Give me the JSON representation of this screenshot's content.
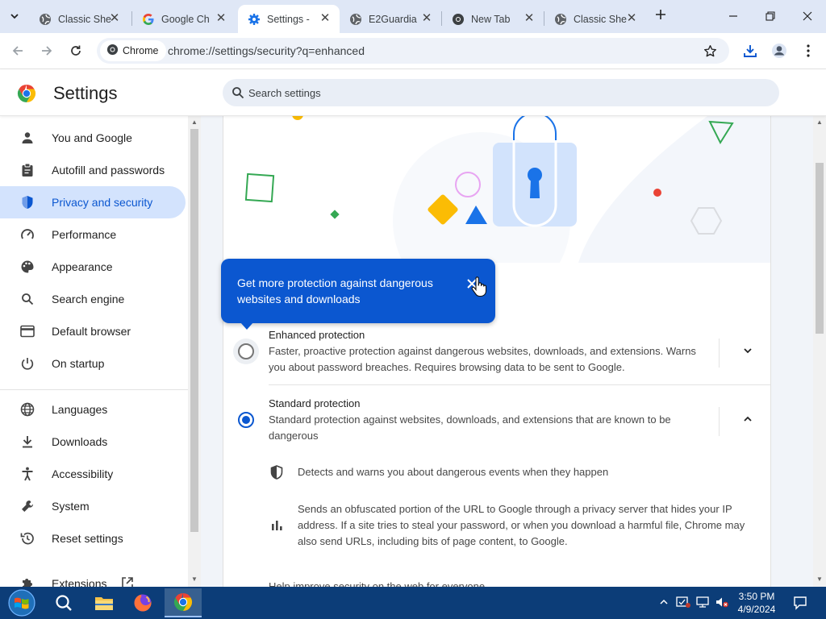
{
  "tabs": [
    {
      "title": "Classic She",
      "favicon": "globe-icon",
      "active": false
    },
    {
      "title": "Google Ch",
      "favicon": "google-icon",
      "active": false
    },
    {
      "title": "Settings -",
      "favicon": "settings-gear-icon",
      "active": true
    },
    {
      "title": "E2Guardia",
      "favicon": "globe-icon",
      "active": false
    },
    {
      "title": "New Tab",
      "favicon": "chrome-icon",
      "active": false
    },
    {
      "title": "Classic She",
      "favicon": "globe-icon",
      "active": false
    }
  ],
  "toolbar": {
    "chip_label": "Chrome",
    "url": "chrome://settings/security?q=enhanced"
  },
  "header": {
    "title": "Settings",
    "search_placeholder": "Search settings"
  },
  "sidebar": {
    "items": [
      {
        "label": "You and Google",
        "icon": "person-icon"
      },
      {
        "label": "Autofill and passwords",
        "icon": "clipboard-icon"
      },
      {
        "label": "Privacy and security",
        "icon": "shield-icon",
        "active": true
      },
      {
        "label": "Performance",
        "icon": "speedometer-icon"
      },
      {
        "label": "Appearance",
        "icon": "palette-icon"
      },
      {
        "label": "Search engine",
        "icon": "search-icon"
      },
      {
        "label": "Default browser",
        "icon": "browser-window-icon"
      },
      {
        "label": "On startup",
        "icon": "power-icon"
      },
      {
        "label": "Languages",
        "icon": "globe-icon"
      },
      {
        "label": "Downloads",
        "icon": "download-icon"
      },
      {
        "label": "Accessibility",
        "icon": "accessibility-icon"
      },
      {
        "label": "System",
        "icon": "wrench-icon"
      },
      {
        "label": "Reset settings",
        "icon": "history-icon"
      },
      {
        "label": "Extensions",
        "icon": "puzzle-icon"
      }
    ]
  },
  "bubble": {
    "text": "Get more protection against dangerous websites and downloads"
  },
  "options": {
    "enhanced": {
      "title": "Enhanced protection",
      "desc": "Faster, proactive protection against dangerous websites, downloads, and extensions. Warns you about password breaches. Requires browsing data to be sent to Google.",
      "selected": false
    },
    "standard": {
      "title": "Standard protection",
      "desc": "Standard protection against websites, downloads, and extensions that are known to be dangerous",
      "selected": true,
      "details": [
        "Detects and warns you about dangerous events when they happen",
        "Sends an obfuscated portion of the URL to Google through a privacy server that hides your IP address. If a site tries to steal your password, or when you download a harmful file, Chrome may also send URLs, including bits of page content, to Google."
      ],
      "cut_off_text": "Help improve security on the web for everyone"
    }
  },
  "taskbar": {
    "time": "3:50 PM",
    "date": "4/9/2024"
  },
  "colors": {
    "accent": "#0b57d0",
    "active_nav_bg": "#d3e3fd",
    "tabstrip_bg": "#dfe7f6",
    "taskbar_bg": "#0c3d78"
  }
}
